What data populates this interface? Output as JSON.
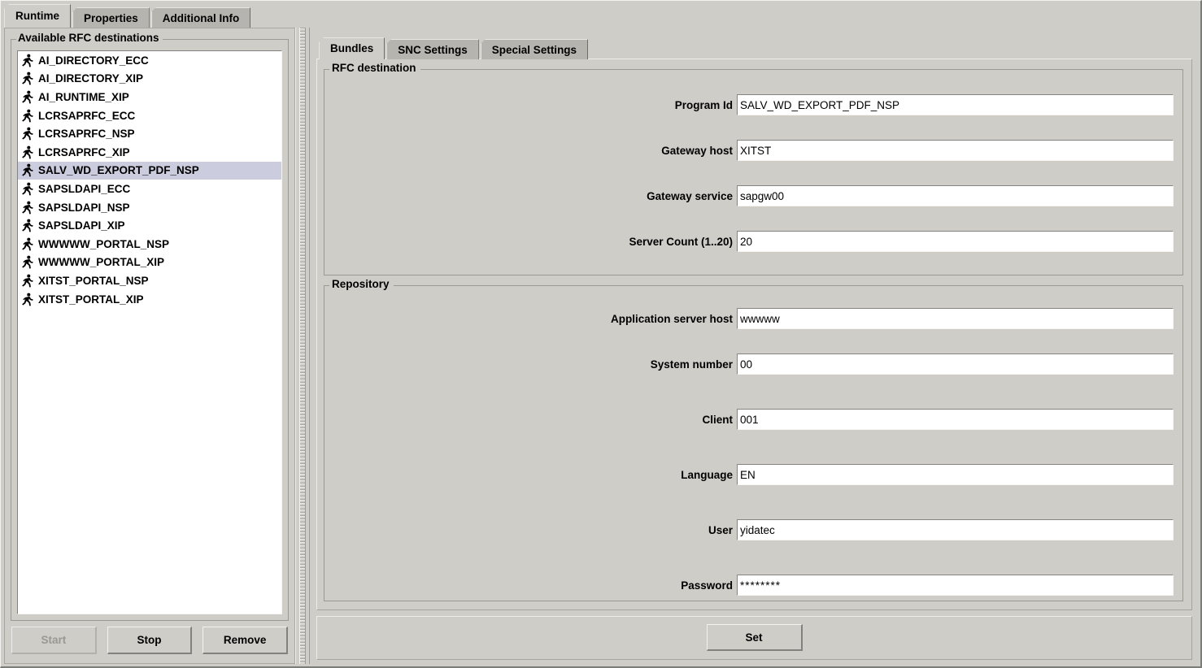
{
  "window": {
    "tabs": [
      {
        "label": "Runtime",
        "selected": true
      },
      {
        "label": "Properties",
        "selected": false
      },
      {
        "label": "Additional Info",
        "selected": false
      }
    ]
  },
  "left_panel": {
    "group_title": "Available RFC destinations",
    "icon": "running-person-icon",
    "selection_color": "#ccccdf",
    "destinations": [
      {
        "name": "AI_DIRECTORY_ECC",
        "selected": false
      },
      {
        "name": "AI_DIRECTORY_XIP",
        "selected": false
      },
      {
        "name": "AI_RUNTIME_XIP",
        "selected": false
      },
      {
        "name": "LCRSAPRFC_ECC",
        "selected": false
      },
      {
        "name": "LCRSAPRFC_NSP",
        "selected": false
      },
      {
        "name": "LCRSAPRFC_XIP",
        "selected": false
      },
      {
        "name": "SALV_WD_EXPORT_PDF_NSP",
        "selected": true
      },
      {
        "name": "SAPSLDAPI_ECC",
        "selected": false
      },
      {
        "name": "SAPSLDAPI_NSP",
        "selected": false
      },
      {
        "name": "SAPSLDAPI_XIP",
        "selected": false
      },
      {
        "name": "WWWWW_PORTAL_NSP",
        "selected": false
      },
      {
        "name": "WWWWW_PORTAL_XIP",
        "selected": false
      },
      {
        "name": "XITST_PORTAL_NSP",
        "selected": false
      },
      {
        "name": "XITST_PORTAL_XIP",
        "selected": false
      }
    ],
    "buttons": [
      {
        "label": "Start",
        "enabled": false
      },
      {
        "label": "Stop",
        "enabled": true
      },
      {
        "label": "Remove",
        "enabled": true
      }
    ]
  },
  "right_panel": {
    "tabs": [
      {
        "label": "Bundles",
        "selected": true
      },
      {
        "label": "SNC Settings",
        "selected": false
      },
      {
        "label": "Special Settings",
        "selected": false
      }
    ],
    "rfc_destination": {
      "group_title": "RFC destination",
      "fields": [
        {
          "label": "Program Id",
          "value": "SALV_WD_EXPORT_PDF_NSP",
          "type": "text"
        },
        {
          "label": "Gateway host",
          "value": "XITST",
          "type": "text"
        },
        {
          "label": "Gateway service",
          "value": "sapgw00",
          "type": "text"
        },
        {
          "label": "Server Count (1..20)",
          "value": "20",
          "type": "text"
        }
      ]
    },
    "repository": {
      "group_title": "Repository",
      "fields": [
        {
          "label": "Application server host",
          "value": "wwwww",
          "type": "text"
        },
        {
          "label": "System number",
          "value": "00",
          "type": "text"
        },
        {
          "label": "Client",
          "value": "001",
          "type": "text"
        },
        {
          "label": "Language",
          "value": "EN",
          "type": "text"
        },
        {
          "label": "User",
          "value": "yidatec",
          "type": "text"
        },
        {
          "label": "Password",
          "value": "********",
          "type": "password"
        }
      ]
    },
    "set_button_label": "Set"
  }
}
